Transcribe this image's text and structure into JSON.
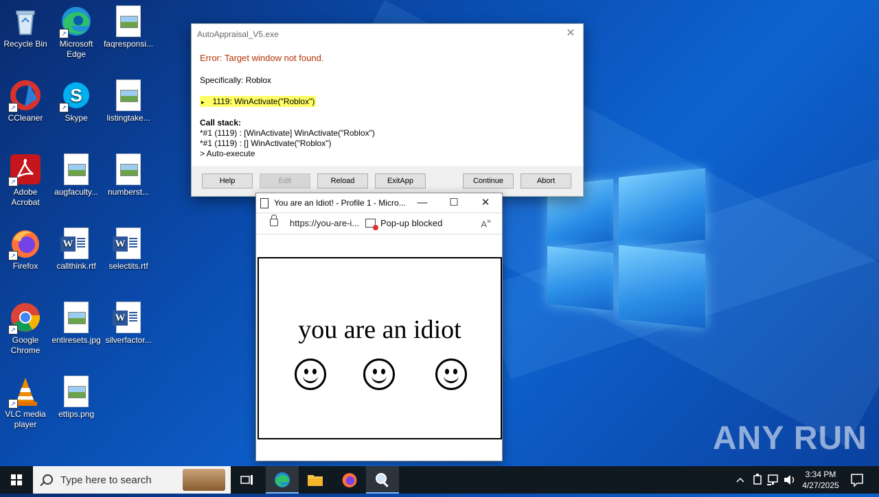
{
  "desktop": {
    "icons": [
      {
        "label": "Recycle Bin"
      },
      {
        "label": "Microsoft Edge"
      },
      {
        "label": "faqresponsi..."
      },
      {
        "label": "CCleaner"
      },
      {
        "label": "Skype"
      },
      {
        "label": "listingtake..."
      },
      {
        "label": "Adobe Acrobat"
      },
      {
        "label": "augfaculty..."
      },
      {
        "label": "numberst..."
      },
      {
        "label": "Firefox"
      },
      {
        "label": "callthink.rtf"
      },
      {
        "label": "selectits.rtf"
      },
      {
        "label": "Google Chrome"
      },
      {
        "label": "entiresets.jpg"
      },
      {
        "label": "silverfactor..."
      },
      {
        "label": "VLC media player"
      },
      {
        "label": "ettips.png"
      }
    ]
  },
  "dialog": {
    "title": "AutoAppraisal_V5.exe",
    "error": "Error: Target window not found.",
    "specifically": "Specifically: Roblox",
    "line_marker": "▸",
    "line": "1119: WinActivate(\"Roblox\")",
    "callstack_label": "Call stack:",
    "callstack": [
      "*#1 (1119) : [WinActivate] WinActivate(\"Roblox\")",
      "*#1 (1119) : [] WinActivate(\"Roblox\")",
      "> Auto-execute"
    ],
    "buttons": {
      "help": "Help",
      "edit": "Edit",
      "reload": "Reload",
      "exitapp": "ExitApp",
      "continue": "Continue",
      "abort": "Abort"
    }
  },
  "browser": {
    "title": "You are an Idiot! - Profile 1 - Micro...",
    "url": "https://you-are-i...",
    "popup_blocked": "Pop-up blocked",
    "page_text": "you are an idiot"
  },
  "watermark": "ANY RUN",
  "taskbar": {
    "search_placeholder": "Type here to search",
    "time": "3:34 PM",
    "date": "4/27/2025"
  }
}
